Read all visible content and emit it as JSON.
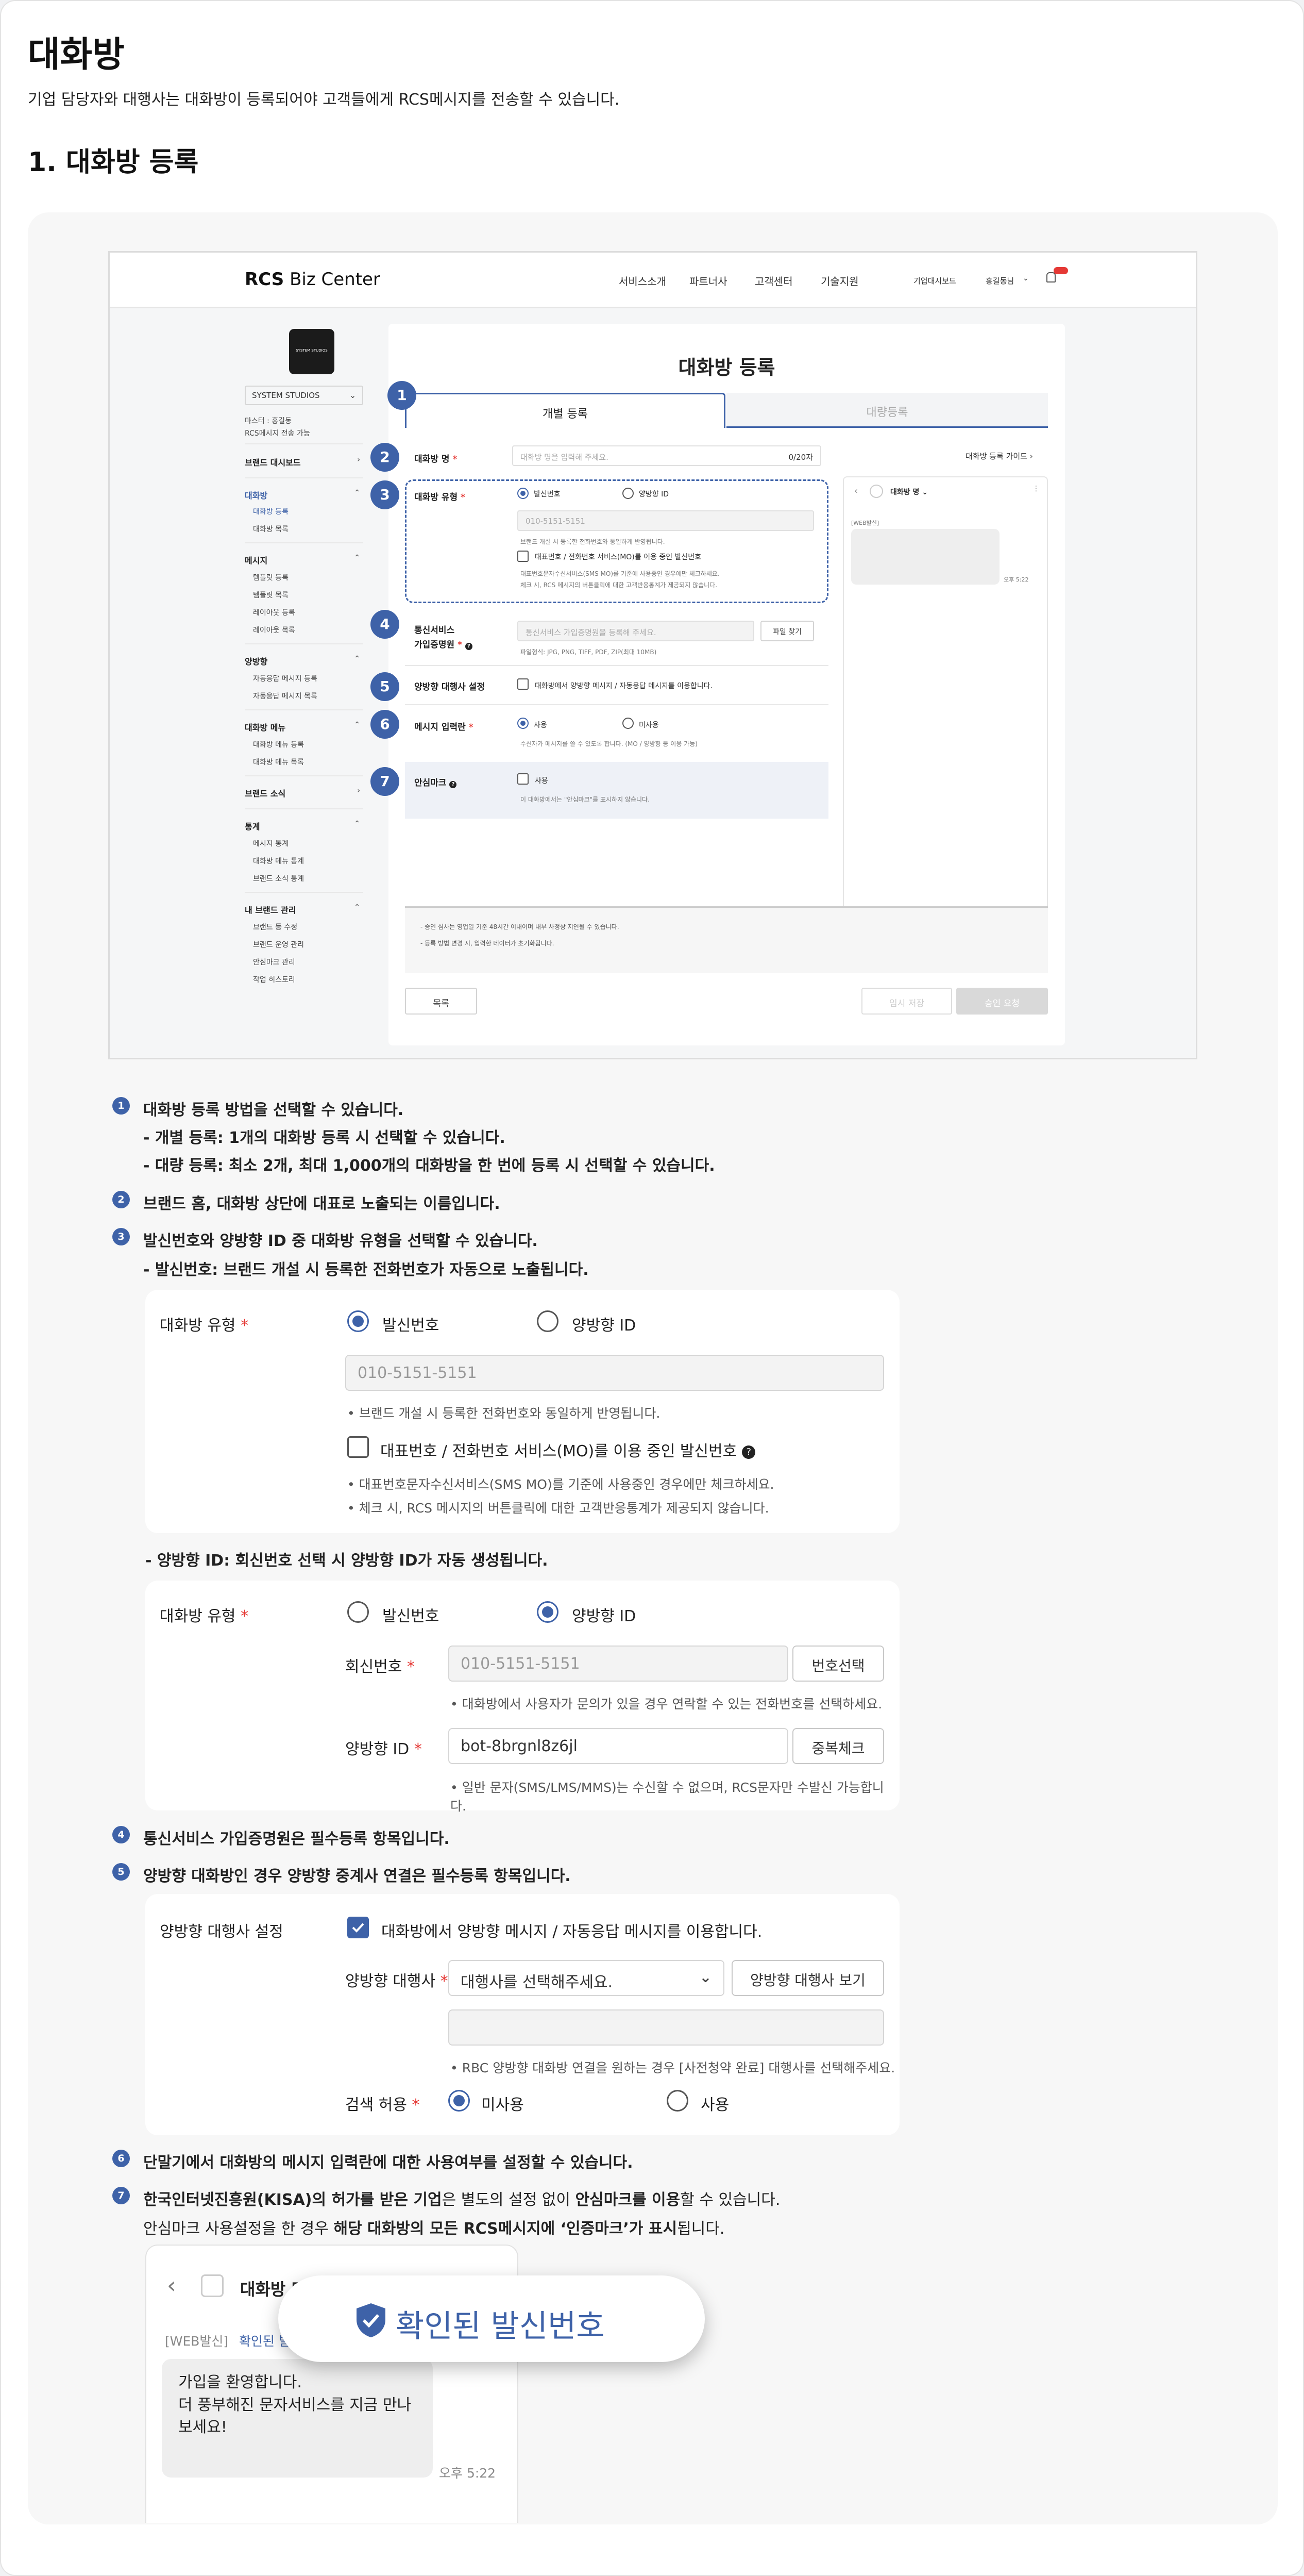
{
  "page": {
    "title": "대화방",
    "subtitle": "기업 담당자와 대행사는 대화방이 등록되어야 고객들에게 RCS메시지를 전송할 수 있습니다.",
    "section_title": "1. 대화방 등록"
  },
  "screenshot": {
    "logo_bold": "RCS",
    "logo_rest": " Biz Center",
    "nav": [
      "서비스소개",
      "파트너사",
      "고객센터",
      "기술지원"
    ],
    "nav_right": [
      "기업대시보드",
      "홍길동님"
    ],
    "brand_logo_text": "SYSTEM STUDIOS",
    "brand_select": "SYSTEM STUDIOS",
    "master_line1": "마스터 : 홍길동",
    "master_line2": "RCS메시지 전송 가능",
    "sidebar": {
      "dashboard": "브랜드 대시보드",
      "chatroom": "대화방",
      "chatroom_items": [
        "대화방 등록",
        "대화방 목록"
      ],
      "message": "메시지",
      "message_items": [
        "템플릿 등록",
        "템플릿 목록",
        "레이아웃 등록",
        "레이아웃 목록"
      ],
      "twoway": "양방향",
      "twoway_items": [
        "자동응답 메시지 등록",
        "자동응답 메시지 목록"
      ],
      "menu": "대화방 메뉴",
      "menu_items": [
        "대화방 메뉴 등록",
        "대화방 메뉴 목록"
      ],
      "news": "브랜드 소식",
      "stats": "통계",
      "stats_items": [
        "메시지 통계",
        "대화방 메뉴 통계",
        "브랜드 소식 통계"
      ],
      "mybrand": "내 브랜드 관리",
      "mybrand_items": [
        "브랜드 등 수정",
        "브랜드 운영 관리",
        "안심마크 관리",
        "작업 히스토리"
      ]
    },
    "form": {
      "title": "대화방 등록",
      "tab_single": "개별 등록",
      "tab_bulk": "대량등록",
      "name_label": "대화방 명",
      "name_placeholder": "대화방 명을 입력해 주세요.",
      "name_count": "0/20자",
      "guide_link": "대화방 등록 가이드",
      "type_label": "대화방 유형",
      "type_opt1": "발신번호",
      "type_opt2": "양방향 ID",
      "type_value": "010-5151-5151",
      "type_note": "브랜드 개설 시 등록한 전화번호와 동일하게 반영됩니다.",
      "mo_check": "대표번호 / 전화번호 서비스(MO)를 이용 중인 발신번호",
      "mo_note1": "대표번호문자수신서비스(SMS MO)를 기준에 사용중인 경우에만 체크하세요.",
      "mo_note2": "체크 시, RCS 메시지의 버튼클릭에 대한 고객반응통계가 제공되지 않습니다.",
      "cert_label1": "통신서비스",
      "cert_label2": "가입증명원",
      "cert_placeholder": "통신서비스 가입증명원을 등록해 주세요.",
      "cert_btn": "파일 찾기",
      "cert_note": "파일형식: JPG, PNG, TIFF, PDF, ZIP(최대 10MB)",
      "agency_label": "양방향 대행사 설정",
      "agency_check": "대화방에서 양방향 메시지 / 자동응답 메시지를 이용합니다.",
      "input_label": "메시지 입력란",
      "input_opt1": "사용",
      "input_opt2": "미사용",
      "input_note": "수신자가 메시지를 쓸 수 있도록 합니다. (MO / 양방향 등 이용 가능)",
      "safe_label": "안심마크",
      "safe_check": "사용",
      "safe_note": "이 대화방에서는 \"안심마크\"를 표시하지 않습니다.",
      "preview_title": "대화방 명",
      "preview_tag": "[WEB발신]",
      "preview_time": "오후 5:22",
      "notice1": "- 승인 심사는 영업일 기준 48시간 이내이며 내부 사정상 지연될 수 있습니다.",
      "notice2": "- 등록 방법 변경 시, 입력한 데이터가 초기화됩니다.",
      "btn_list": "목록",
      "btn_temp": "임시 저장",
      "btn_submit": "승인 요청"
    }
  },
  "steps": {
    "s1_title": "대화방 등록 방법을 선택할 수 있습니다.",
    "s1_l1": "- 개별 등록: 1개의 대화방 등록 시 선택할 수 있습니다.",
    "s1_l2": "- 대량 등록: 최소 2개, 최대 1,000개의 대화방을 한 번에 등록 시 선택할 수 있습니다.",
    "s2": "브랜드 홈, 대화방 상단에 대표로 노출되는 이름입니다.",
    "s3_title": "발신번호와 양방향 ID 중 대화방 유형을 선택할 수 있습니다.",
    "s3_l1": "- 발신번호: 브랜드 개설 시 등록한 전화번호가 자동으로 노출됩니다.",
    "s3_l2": "- 양방향 ID: 회신번호 선택 시 양방향 ID가 자동 생성됩니다.",
    "s4": "통신서비스 가입증명원은 필수등록 항목입니다.",
    "s5": "양방향 대화방인 경우 양방향 중계사 연결은 필수등록 항목입니다.",
    "s6": "단말기에서 대화방의 메시지 입력란에 대한 사용여부를 설정할 수 있습니다.",
    "s7_bold1": "한국인터넷진흥원(KISA)의 허가를 받은 기업",
    "s7_mid": "은 별도의 설정 없이 ",
    "s7_bold2": "안심마크를 이용",
    "s7_end": "할 수 있습니다.",
    "s7_l2a": "안심마크 사용설정을 한 경우 ",
    "s7_l2b": "해당 대화방의 모든 RCS메시지에 ‘인증마크’가 표시",
    "s7_l2c": "됩니다."
  },
  "detail1": {
    "label": "대화방 유형",
    "opt1": "발신번호",
    "opt2": "양방향 ID",
    "value": "010-5151-5151",
    "note": "브랜드 개설 시 등록한 전화번호와 동일하게 반영됩니다.",
    "mo_check": "대표번호 / 전화번호  서비스(MO)를 이용 중인 발신번호",
    "mo_note1": "대표번호문자수신서비스(SMS MO)를 기준에 사용중인 경우에만 체크하세요.",
    "mo_note2": "체크 시, RCS 메시지의 버튼클릭에 대한 고객반응통계가 제공되지 않습니다."
  },
  "detail2": {
    "label": "대화방 유형",
    "opt1": "발신번호",
    "opt2": "양방향 ID",
    "reply_label": "회신번호",
    "reply_value": "010-5151-5151",
    "reply_btn": "번호선택",
    "reply_note": "대화방에서 사용자가 문의가 있을 경우 연락할 수 있는 전화번호를 선택하세요.",
    "id_label": "양방향 ID",
    "id_value": "bot-8brgnl8z6jl",
    "id_btn": "중복체크",
    "id_note": "일반 문자(SMS/LMS/MMS)는 수신할 수 없으며, RCS문자만 수발신 가능합니다."
  },
  "detail3": {
    "label": "양방향 대행사 설정",
    "check": "대화방에서 양방향 메시지 / 자동응답 메시지를 이용합니다.",
    "agency_label": "양방향 대행사",
    "agency_select": "대행사를 선택해주세요.",
    "agency_btn": "양방향 대행사 보기",
    "agency_note": "RBC 양방향 대화방 연결을 원하는 경우 [사전청약 완료] 대행사를 선택해주세요.",
    "search_label": "검색 허용",
    "search_opt1": "미사용",
    "search_opt2": "사용"
  },
  "chat": {
    "title": "대화방 명",
    "tag": "[WEB발신]",
    "verified_short": "확인된 발",
    "message": "가입을 환영합니다.\n더 풍부해진 문자서비스를 지금 만나보세요!",
    "time": "오후 5:22",
    "badge": "확인된 발신번호"
  },
  "colors": {
    "accent": "#3e62a8",
    "badge_text": "#3e62a8"
  }
}
